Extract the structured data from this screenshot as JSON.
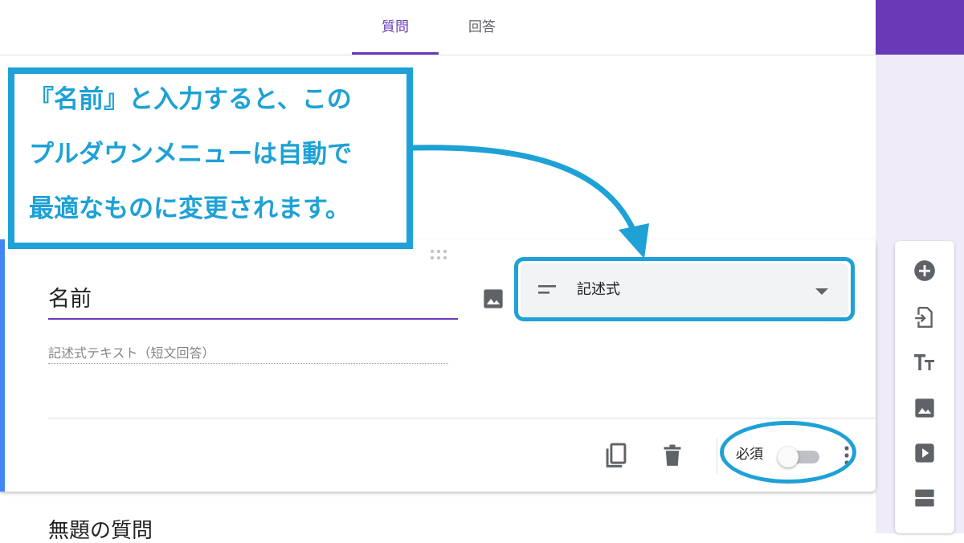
{
  "tabs": [
    {
      "label": "質問",
      "active": true
    },
    {
      "label": "回答",
      "active": false
    }
  ],
  "question": {
    "title": "名前",
    "type_label": "記述式",
    "answer_placeholder": "記述式テキスト（短文回答）",
    "required_label": "必須",
    "required_on": false
  },
  "next_question": {
    "title": "無題の質問"
  },
  "annotation": {
    "lines": [
      "『名前』と入力すると、この",
      "プルダウンメニューは自動で",
      "最適なものに変更されます。"
    ]
  },
  "side_toolbar": {
    "icons": [
      "add-question-icon",
      "import-questions-icon",
      "add-title-icon",
      "add-image-icon",
      "add-video-icon",
      "add-section-icon"
    ]
  },
  "colors": {
    "accent": "#673ab7",
    "annotation": "#1da1d6",
    "card_left_accent": "#4285f4"
  }
}
